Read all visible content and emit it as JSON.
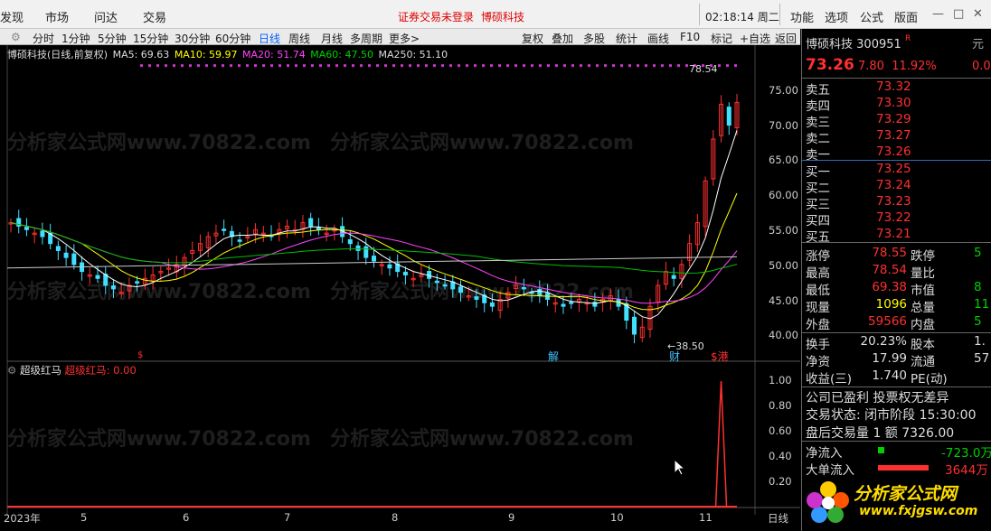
{
  "nav": {
    "items": [
      "发现",
      "市场",
      "问达",
      "交易"
    ],
    "notice": "证券交易未登录",
    "stock_link": "博硕科技",
    "clock": "02:18:14 周二",
    "right_menu": [
      "功能",
      "选项",
      "公式",
      "版面"
    ]
  },
  "periods": {
    "items": [
      "分时",
      "1分钟",
      "5分钟",
      "15分钟",
      "30分钟",
      "60分钟",
      "日线",
      "周线",
      "月线",
      "多周期",
      "更多>"
    ],
    "active": "日线",
    "tools": [
      "复权",
      "叠加",
      "多股",
      "统计",
      "画线",
      "F10",
      "标记",
      "+自选",
      "返回"
    ]
  },
  "ma": {
    "title": "博硕科技(日线,前复权)",
    "ma5": "MA5: 69.63",
    "ma10": "MA10: 59.97",
    "ma20": "MA20: 51.74",
    "ma60": "MA60: 47.50",
    "ma250": "MA250: 51.10"
  },
  "price_axis": [
    "75.00",
    "70.00",
    "65.00",
    "60.00",
    "55.00",
    "50.00",
    "45.00",
    "40.00"
  ],
  "price_marks": {
    "high": "78.54",
    "low": "38.50"
  },
  "event_marks": [
    "$",
    "解",
    "财",
    "$港"
  ],
  "time_axis": [
    "2023年",
    "5",
    "6",
    "7",
    "8",
    "9",
    "10",
    "11"
  ],
  "sub": {
    "name": "超级红马",
    "value": "超级红马: 0.00",
    "axis": [
      "1.00",
      "0.80",
      "0.60",
      "0.40",
      "0.20"
    ]
  },
  "period_footer": "日线",
  "quote": {
    "name": "博硕科技",
    "code": "300951",
    "tag": "R",
    "price": "73.26",
    "change": "7.80",
    "pct": "11.92%",
    "side_cut": "元",
    "side_cut2": "0.0",
    "sells": [
      {
        "l": "卖五",
        "p": "73.32"
      },
      {
        "l": "卖四",
        "p": "73.30"
      },
      {
        "l": "卖三",
        "p": "73.29"
      },
      {
        "l": "卖二",
        "p": "73.27"
      },
      {
        "l": "卖一",
        "p": "73.26"
      }
    ],
    "buys": [
      {
        "l": "买一",
        "p": "73.25"
      },
      {
        "l": "买二",
        "p": "73.24"
      },
      {
        "l": "买三",
        "p": "73.23"
      },
      {
        "l": "买四",
        "p": "73.22"
      },
      {
        "l": "买五",
        "p": "73.21"
      }
    ],
    "stats": [
      {
        "l1": "涨停",
        "v1": "78.55",
        "l2": "跌停",
        "v2": "5"
      },
      {
        "l1": "最高",
        "v1": "78.54",
        "l2": "量比",
        "v2": ""
      },
      {
        "l1": "最低",
        "v1": "69.38",
        "l2": "市值",
        "v2": "8"
      },
      {
        "l1": "现量",
        "v1": "1096",
        "l2": "总量",
        "v2": "11"
      },
      {
        "l1": "外盘",
        "v1": "59566",
        "l2": "内盘",
        "v2": "5"
      }
    ],
    "stats2": [
      {
        "l1": "换手",
        "v1": "20.23%",
        "l2": "股本",
        "v2": "1."
      },
      {
        "l1": "净资",
        "v1": "17.99",
        "l2": "流通",
        "v2": "57"
      },
      {
        "l1": "收益(三)",
        "v1": "1.740",
        "l2": "PE(动)",
        "v2": ""
      }
    ],
    "info1": "公司已盈利 投票权无差异",
    "info2": "交易状态: 闭市阶段 15:30:00",
    "info3": "盘后交易量 1 额 7326.00",
    "flow1": {
      "l": "净流入",
      "v": "-723.0万"
    },
    "flow2": {
      "l": "大单流入",
      "v": "3644万"
    }
  },
  "logo": {
    "text": "分析家公式网",
    "url": "www.fxjgsw.com"
  },
  "watermark": "分析家公式网www.70822.com",
  "chart_data": {
    "type": "candlestick",
    "title": "博硕科技(日线,前复权)",
    "ylim": [
      38,
      80
    ],
    "closes": [
      56,
      55.5,
      55,
      54.5,
      54,
      53,
      52,
      51,
      50,
      49,
      48.5,
      48,
      47,
      46.5,
      46,
      47,
      47.5,
      48,
      48.5,
      49,
      49.5,
      50,
      51,
      52,
      53,
      54,
      54.5,
      55,
      54,
      53.5,
      54,
      55,
      54.5,
      54,
      55,
      55.5,
      55,
      56,
      55.5,
      55,
      54.5,
      55,
      54,
      53,
      52,
      51,
      50.5,
      50,
      49.5,
      49,
      48.5,
      48,
      48.5,
      48,
      47.5,
      47,
      46.5,
      46,
      45.5,
      45,
      44.5,
      44,
      45,
      46,
      47,
      46.5,
      46,
      45.5,
      45,
      44.5,
      44,
      44.5,
      45,
      44.5,
      44,
      45,
      45.5,
      44,
      42,
      40,
      41,
      44,
      47,
      49,
      48,
      50,
      53,
      56,
      62,
      68,
      73,
      70,
      73.26
    ],
    "ma5_last": 69.63,
    "ma10_last": 59.97,
    "ma20_last": 51.74,
    "ma60_last": 47.5,
    "ma250_last": 51.1,
    "sub_series": {
      "name": "超级红马",
      "spike_value": 1.0
    }
  }
}
